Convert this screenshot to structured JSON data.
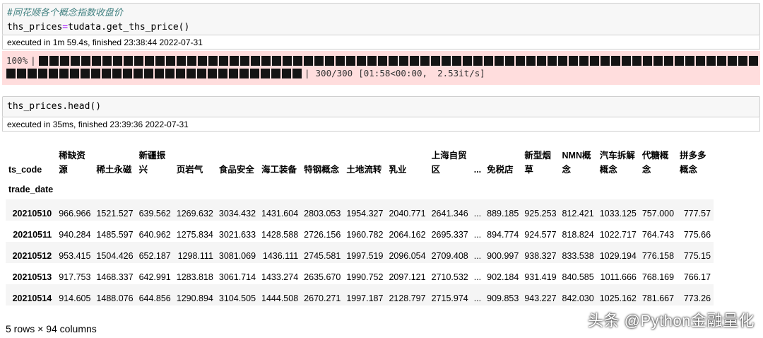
{
  "cells": [
    {
      "comment": "#同花顺各个概念指数收盘价",
      "code_lhs": "ths_prices",
      "code_op": "=",
      "code_rhs": "tudata.get_ths_price()",
      "exec_info": "executed in 1m 59.4s, finished 23:38:44 2022-07-31"
    },
    {
      "code": "ths_prices.head()",
      "exec_info": "executed in 35ms, finished 23:39:36 2022-07-31"
    }
  ],
  "progress": {
    "percent_label": "100%",
    "pipe": "|",
    "count": "300/300",
    "timing": "[01:58<00:00,",
    "rate": "2.53it/s]",
    "value": 1.0
  },
  "dataframe": {
    "columns_index_name": "ts_code",
    "rows_index_name": "trade_date",
    "columns": [
      "稀缺资源",
      "稀土永磁",
      "新疆振兴",
      "页岩气",
      "食品安全",
      "海工装备",
      "特钢概念",
      "土地流转",
      "乳业",
      "上海自贸区",
      "...",
      "免税店",
      "新型烟草",
      "NMN概念",
      "汽车拆解概念",
      "代糖概念",
      "拼多多概念"
    ],
    "rows": [
      {
        "index": "20210510",
        "values": [
          "966.966",
          "1521.527",
          "639.562",
          "1269.632",
          "3034.432",
          "1431.604",
          "2803.053",
          "1954.327",
          "2040.771",
          "2641.346",
          "...",
          "889.185",
          "925.253",
          "812.421",
          "1033.125",
          "757.000",
          "777.57"
        ]
      },
      {
        "index": "20210511",
        "values": [
          "940.284",
          "1485.597",
          "640.962",
          "1275.834",
          "3021.633",
          "1428.588",
          "2726.156",
          "1960.782",
          "2064.162",
          "2695.337",
          "...",
          "894.774",
          "924.577",
          "818.824",
          "1022.717",
          "764.743",
          "775.66"
        ]
      },
      {
        "index": "20210512",
        "values": [
          "953.415",
          "1504.426",
          "652.187",
          "1298.111",
          "3081.069",
          "1436.111",
          "2745.581",
          "1997.519",
          "2096.054",
          "2709.408",
          "...",
          "900.997",
          "938.327",
          "833.538",
          "1029.194",
          "776.158",
          "775.15"
        ]
      },
      {
        "index": "20210513",
        "values": [
          "917.753",
          "1468.337",
          "642.991",
          "1283.818",
          "3061.714",
          "1433.274",
          "2635.670",
          "1990.752",
          "2097.121",
          "2710.532",
          "...",
          "902.184",
          "931.419",
          "840.585",
          "1011.666",
          "768.169",
          "766.17"
        ]
      },
      {
        "index": "20210514",
        "values": [
          "914.605",
          "1488.076",
          "644.856",
          "1290.894",
          "3104.505",
          "1444.508",
          "2670.271",
          "1997.187",
          "2128.797",
          "2715.974",
          "...",
          "909.853",
          "943.227",
          "842.030",
          "1025.162",
          "781.667",
          "773.26"
        ]
      }
    ],
    "shape_label": "5 rows × 94 columns"
  },
  "watermark": "头条 @Python金融量化"
}
